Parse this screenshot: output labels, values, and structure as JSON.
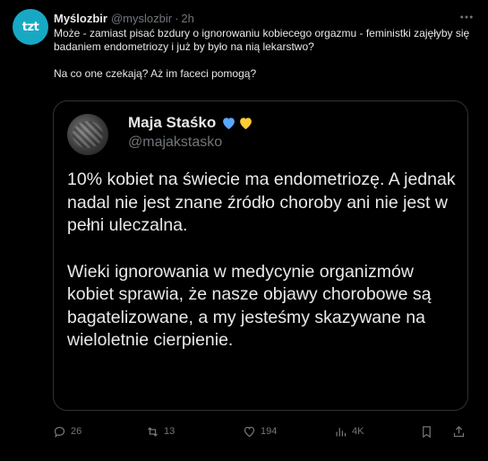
{
  "tweet": {
    "avatar_text": "tzt",
    "author_name": "Myślozbir",
    "handle": "@myslozbir",
    "separator": "·",
    "time": "2h",
    "text_line1": "Może - zamiast pisać bzdury o ignorowaniu kobiecego orgazmu - feministki zajęłyby się badaniem endometriozy i już by było na nią lekarstwo?",
    "text_line2": "Na co one czekają? Aż im faceci pomogą?"
  },
  "quoted_tweet": {
    "author_name": "Maja Staśko",
    "handle": "@majakstasko",
    "emoji_icons": [
      "blue-heart-icon",
      "yellow-heart-icon"
    ],
    "paragraph1": "10% kobiet na świecie ma endometriozę. A jednak nadal nie jest znane źródło choroby ani nie jest w pełni uleczalna.",
    "paragraph2": "Wieki ignorowania w medycynie organizmów kobiet sprawia, że nasze objawy chorobowe są bagatelizowane, a my jesteśmy skazywane na wieloletnie cierpienie."
  },
  "actions": {
    "replies": "26",
    "reposts": "13",
    "likes": "194",
    "views": "4K"
  },
  "colors": {
    "background": "#000000",
    "text": "#e7e9ea",
    "muted": "#71767b",
    "border": "#2f3336",
    "avatar_bg": "#17a9c4",
    "heart_blue": "#5aa8ff",
    "heart_yellow": "#ffcc33"
  }
}
